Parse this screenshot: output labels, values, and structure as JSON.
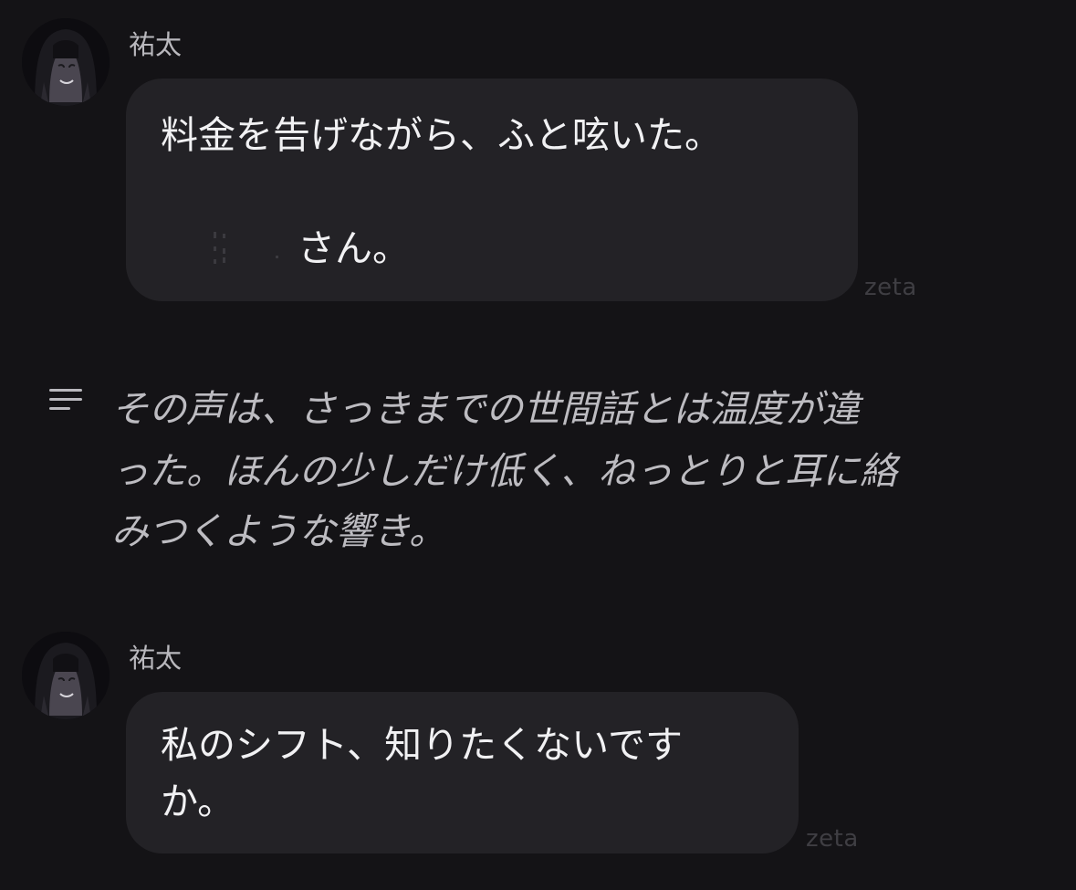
{
  "messages": [
    {
      "sender": "祐太",
      "lines": [
        "料金を告げながら、ふと呟いた。",
        "さん。"
      ],
      "watermark": "zeta"
    },
    {
      "sender": "祐太",
      "lines": [
        "私のシフト、知りたくないです",
        "か。"
      ],
      "watermark": "zeta"
    }
  ],
  "narration": {
    "icon": "narration-lines-icon",
    "lines": [
      "その声は、さっきまでの世間話とは温度が違",
      "った。ほんの少しだけ低く、ねっとりと耳に絡",
      "みつくような響き。"
    ]
  },
  "colors": {
    "background": "#141316",
    "bubble": "#232226",
    "message_text": "#f1f1f3",
    "narration_text": "#bdbcc1",
    "name_text": "#b9b8bd",
    "watermark_text": "#3f3e43"
  }
}
